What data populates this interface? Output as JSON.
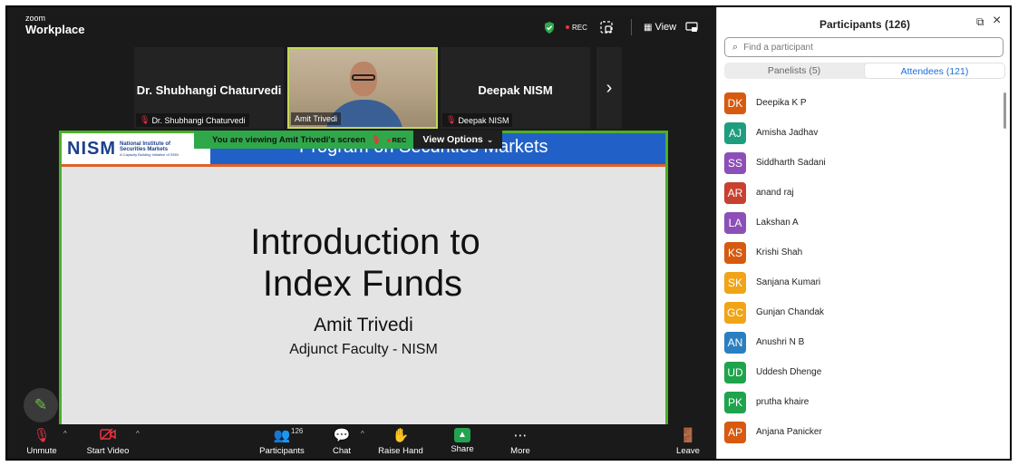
{
  "app": {
    "brand_top": "zoom",
    "brand_bottom": "Workplace"
  },
  "topbar": {
    "rec_label": "REC",
    "view_label": "View"
  },
  "tiles": [
    {
      "big_name": "Dr. Shubhangi Chaturvedi",
      "tag": "Dr. Shubhangi Chaturvedi"
    },
    {
      "tag": "Amit Trivedi"
    },
    {
      "big_name": "Deepak NISM",
      "tag": "Deepak NISM"
    }
  ],
  "share_bar": {
    "viewing_text": "You are viewing  Amit Trivedi's screen",
    "rec_label": "REC",
    "view_options": "View Options"
  },
  "slide": {
    "logo_word": "NISM",
    "logo_line1": "National Institute of",
    "logo_line2": "Securities Markets",
    "logo_tagline": "A Capacity Building Initiative of SEBI",
    "header": "Program on Securities Markets",
    "title_line1": "Introduction to",
    "title_line2": "Index Funds",
    "presenter": "Amit Trivedi",
    "role": "Adjunct Faculty - NISM"
  },
  "toolbar": {
    "unmute": "Unmute",
    "start_video": "Start Video",
    "participants": "Participants",
    "participants_count": "126",
    "chat": "Chat",
    "raise_hand": "Raise Hand",
    "share": "Share",
    "more": "More",
    "leave": "Leave"
  },
  "panel": {
    "title": "Participants (126)",
    "search_placeholder": "Find a participant",
    "tabs": [
      "Panelists (5)",
      "Attendees (121)"
    ],
    "attendees": [
      {
        "initials": "DK",
        "name": "Deepika K P",
        "color": "#d65a10"
      },
      {
        "initials": "AJ",
        "name": "Amisha Jadhav",
        "color": "#1e9e7e"
      },
      {
        "initials": "SS",
        "name": "Siddharth Sadani",
        "color": "#8c4fb8"
      },
      {
        "initials": "AR",
        "name": "anand raj",
        "color": "#c8402e"
      },
      {
        "initials": "LA",
        "name": "Lakshan A",
        "color": "#8c4fb8"
      },
      {
        "initials": "KS",
        "name": "Krishi Shah",
        "color": "#d65a10"
      },
      {
        "initials": "SK",
        "name": "Sanjana Kumari",
        "color": "#f0a417"
      },
      {
        "initials": "GC",
        "name": "Gunjan Chandak",
        "color": "#f0a417"
      },
      {
        "initials": "AN",
        "name": "Anushri N B",
        "color": "#2a7fc0"
      },
      {
        "initials": "UD",
        "name": "Uddesh Dhenge",
        "color": "#1fa34c"
      },
      {
        "initials": "PK",
        "name": "prutha khaire",
        "color": "#1fa34c"
      },
      {
        "initials": "AP",
        "name": "Anjana Panicker",
        "color": "#d65a10"
      }
    ]
  }
}
